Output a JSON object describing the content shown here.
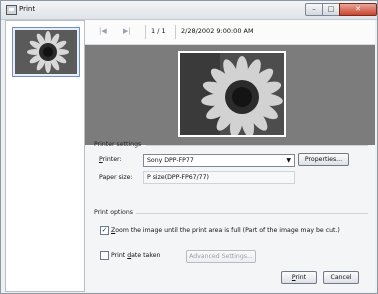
{
  "window": {
    "title": "Print"
  },
  "nav": {
    "first_icon": "first-page-icon",
    "next_icon": "next-page-icon",
    "page_counter": "1 / 1",
    "datetime": "2/28/2002 9:00:00 AM"
  },
  "printer_settings": {
    "section_title": "Printer settings",
    "printer_label_prefix": "P",
    "printer_label_rest": "rinter:",
    "printer_value": "Sony DPP-FP77",
    "properties_button": "Properties...",
    "paper_size_label": "Paper size:",
    "paper_size_value": "P size(DPP-FP67/77)"
  },
  "print_options": {
    "section_title": "Print options",
    "zoom_checked": true,
    "zoom_label_prefix": "Z",
    "zoom_label_rest": "oom the image until the print area is full (Part of the image may be cut.)",
    "print_date_checked": false,
    "print_date_label_a": "Print ",
    "print_date_label_u": "d",
    "print_date_label_b": "ate taken",
    "advanced_button": "Advanced Settings..."
  },
  "actions": {
    "print_button_u": "P",
    "print_button_rest": "rint",
    "cancel_button": "Cancel"
  },
  "colors": {
    "preview_bg": "#7c7c7c",
    "title_bar": "#dfe3e8",
    "close_button": "#c8462e"
  }
}
